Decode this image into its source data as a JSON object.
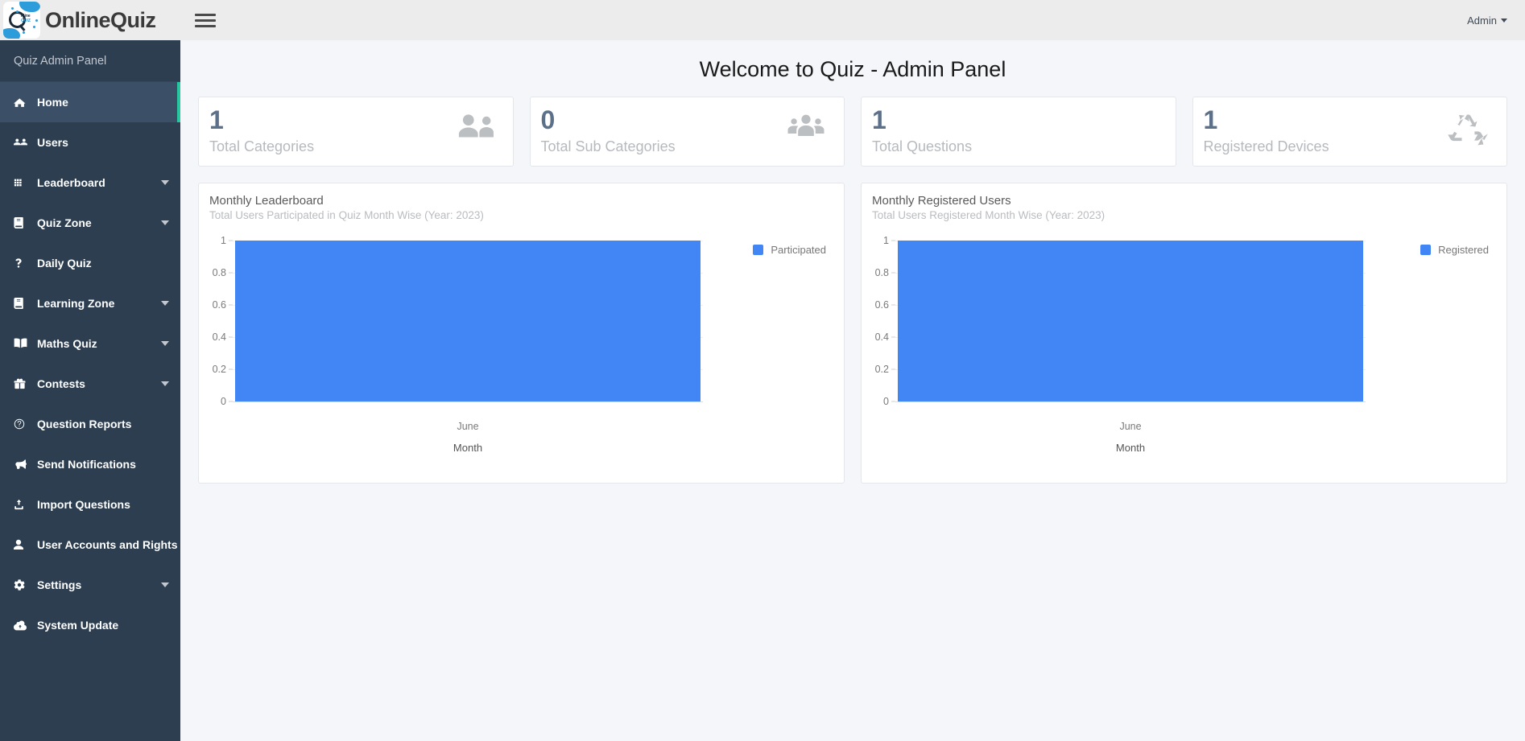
{
  "topbar": {
    "brand_name": "OnlineQuiz",
    "menu_toggle_icon": "hamburger-icon",
    "user_label": "Admin"
  },
  "sidebar": {
    "header": "Quiz Admin Panel",
    "items": [
      {
        "label": "Home",
        "icon": "home-icon",
        "active": true,
        "caret": false
      },
      {
        "label": "Users",
        "icon": "users-icon",
        "active": false,
        "caret": false
      },
      {
        "label": "Leaderboard",
        "icon": "grid-icon",
        "active": false,
        "caret": true
      },
      {
        "label": "Quiz Zone",
        "icon": "book-icon",
        "active": false,
        "caret": true
      },
      {
        "label": "Daily Quiz",
        "icon": "question-icon",
        "active": false,
        "caret": false
      },
      {
        "label": "Learning Zone",
        "icon": "book-icon",
        "active": false,
        "caret": true
      },
      {
        "label": "Maths Quiz",
        "icon": "open-book-icon",
        "active": false,
        "caret": true
      },
      {
        "label": "Contests",
        "icon": "gift-icon",
        "active": false,
        "caret": true
      },
      {
        "label": "Question Reports",
        "icon": "question-circle-icon",
        "active": false,
        "caret": false
      },
      {
        "label": "Send Notifications",
        "icon": "megaphone-icon",
        "active": false,
        "caret": false
      },
      {
        "label": "Import Questions",
        "icon": "upload-icon",
        "active": false,
        "caret": false
      },
      {
        "label": "User Accounts and Rights",
        "icon": "user-icon",
        "active": false,
        "caret": false
      },
      {
        "label": "Settings",
        "icon": "gear-icon",
        "active": false,
        "caret": true
      },
      {
        "label": "System Update",
        "icon": "cloud-download-icon",
        "active": false,
        "caret": false
      }
    ]
  },
  "main": {
    "page_title": "Welcome to Quiz - Admin Panel",
    "stat_cards": [
      {
        "value": "1",
        "label": "Total Categories",
        "icon": "two-users-icon"
      },
      {
        "value": "0",
        "label": "Total Sub Categories",
        "icon": "three-users-icon"
      },
      {
        "value": "1",
        "label": "Total Questions",
        "icon": "question-circle-icon"
      },
      {
        "value": "1",
        "label": "Registered Devices",
        "icon": "recycle-icon"
      }
    ]
  },
  "colors": {
    "sidebar_bg": "#2c3e50",
    "sidebar_active_bg": "#3b5066",
    "sidebar_active_accent": "#26c6a0",
    "bar_blue": "#4285f4",
    "stat_number": "#5c7089",
    "page_bg": "#f4f6f9"
  },
  "chart_data": [
    {
      "type": "bar",
      "title": "Monthly Leaderboard",
      "subtitle": "Total Users Participated in Quiz Month Wise (Year: 2023)",
      "categories": [
        "June"
      ],
      "series": [
        {
          "name": "Participated",
          "values": [
            1
          ]
        }
      ],
      "values": [
        1
      ],
      "xlabel": "Month",
      "ylabel": "",
      "ylim": [
        0,
        1
      ],
      "yticks": [
        "1",
        "0.8",
        "0.6",
        "0.4",
        "0.2",
        "0"
      ],
      "ytick_values": [
        1,
        0.8,
        0.6,
        0.4,
        0.2,
        0
      ],
      "legend": [
        "Participated"
      ],
      "legend_position": "right",
      "grid": true,
      "bar_color": "#4285f4"
    },
    {
      "type": "bar",
      "title": "Monthly Registered Users",
      "subtitle": "Total Users Registered Month Wise (Year: 2023)",
      "categories": [
        "June"
      ],
      "series": [
        {
          "name": "Registered",
          "values": [
            1
          ]
        }
      ],
      "values": [
        1
      ],
      "xlabel": "Month",
      "ylabel": "",
      "ylim": [
        0,
        1
      ],
      "yticks": [
        "1",
        "0.8",
        "0.6",
        "0.4",
        "0.2",
        "0"
      ],
      "ytick_values": [
        1,
        0.8,
        0.6,
        0.4,
        0.2,
        0
      ],
      "legend": [
        "Registered"
      ],
      "legend_position": "right",
      "grid": true,
      "bar_color": "#4285f4"
    }
  ]
}
